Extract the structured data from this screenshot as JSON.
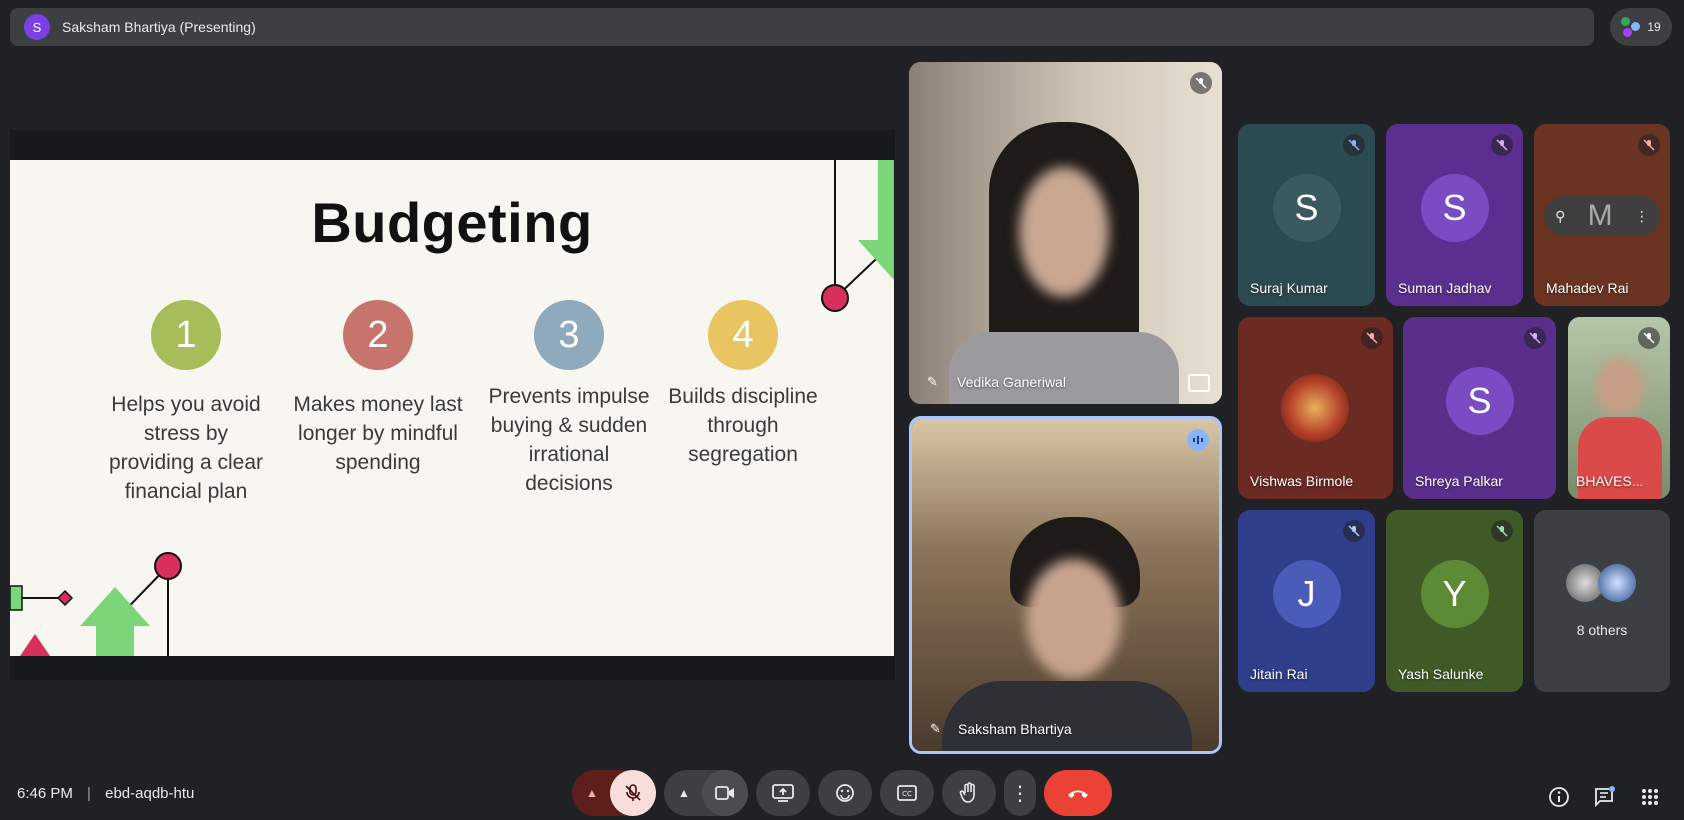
{
  "top_bar": {
    "presenter_initial": "S",
    "title": "Saksham Bhartiya (Presenting)",
    "participant_count": "19"
  },
  "slide": {
    "title": "Budgeting",
    "points": [
      {
        "number": "1",
        "text": "Helps you avoid stress by providing a clear financial plan",
        "color": "#a6bd5a"
      },
      {
        "number": "2",
        "text": "Makes money last longer by mindful spending",
        "color": "#c6746c"
      },
      {
        "number": "3",
        "text": "Prevents impulse buying & sudden irrational decisions",
        "color": "#8fa9bd"
      },
      {
        "number": "4",
        "text": "Builds discipline through segregation",
        "color": "#e8c561"
      }
    ]
  },
  "tiles": [
    {
      "name": "Vedika Ganeriwal",
      "type": "video"
    },
    {
      "name": "Saksham Bhartiya",
      "type": "video",
      "speaking": true
    },
    {
      "name": "Suraj Kumar",
      "initial": "S",
      "bg": "#2b4a52",
      "circle": "#3b5961"
    },
    {
      "name": "Suman Jadhav",
      "initial": "S",
      "bg": "#5b2f8f",
      "circle": "#7b4bc4"
    },
    {
      "name": "Mahadev Rai",
      "initial": "M",
      "bg": "#6a3322"
    },
    {
      "name": "Vishwas Birmole",
      "bg": "#6b2a22"
    },
    {
      "name": "Shreya Palkar",
      "initial": "S",
      "bg": "#5a2f8c",
      "circle": "#7b4bc4"
    },
    {
      "name": "BHAVES...",
      "type": "video"
    },
    {
      "name": "Jitain Rai",
      "initial": "J",
      "bg": "#2f3e8a",
      "circle": "#4a5bb8"
    },
    {
      "name": "Yash Salunke",
      "initial": "Y",
      "bg": "#3f5a27",
      "circle": "#5d8a34"
    },
    {
      "name": "8 others",
      "bg": "#3c4043"
    }
  ],
  "bottom_bar": {
    "time": "6:46 PM",
    "meeting_code": "ebd-aqdb-htu"
  },
  "colors": {
    "end_call": "#ea4335",
    "mic_off": "#f9dedc",
    "accent": "#8ab4f8"
  }
}
